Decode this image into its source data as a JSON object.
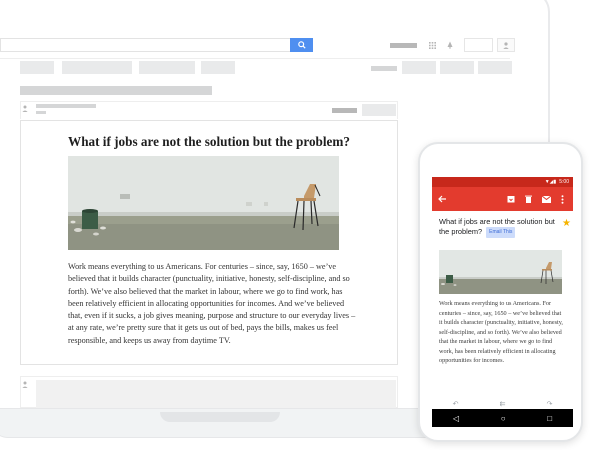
{
  "email": {
    "title": "What if jobs are not the solution but the problem?",
    "body": "Work means everything to us Americans. For centuries – since, say, 1650 – we’ve believed that it builds character (punctuality, initiative, honesty, self-discipline, and so forth). We’ve also believed that the market in labour, where we go to find work, has been relatively efficient in allocating opportunities for incomes. And we’ve believed that, even if it sucks, a job gives meaning, purpose and structure to our everyday lives – at any rate, we’re pretty sure that it gets us out of bed, pays the bills, makes us feel responsible, and keeps us away from daytime TV."
  },
  "phone": {
    "time": "5:00",
    "subject": "What if jobs are not the solution but the problem?",
    "label": "Email This",
    "body": "Work means everything to us Americans. For centuries – since, say, 1650 – we’ve believed that it builds character (punctuality, initiative, honesty, self-discipline, and so forth). We’ve also believed that the market in labour, where we go to find work, has been relatively efficient in allocating opportunities for incomes."
  },
  "icons": {
    "search": "search-icon",
    "apps": "apps-grid-icon",
    "notifications": "bell-icon",
    "account": "account-icon",
    "back": "back-arrow-icon",
    "archive": "archive-icon",
    "delete": "trash-icon",
    "mail": "mail-icon",
    "more": "more-vert-icon",
    "star": "star-icon",
    "reply": "reply-icon",
    "reply_all": "reply-all-icon",
    "forward": "forward-icon"
  },
  "colors": {
    "accent": "#4f8ff0",
    "gmail_red": "#e33b2e",
    "star": "#f6b400",
    "label_chip": "#cddcfb"
  }
}
